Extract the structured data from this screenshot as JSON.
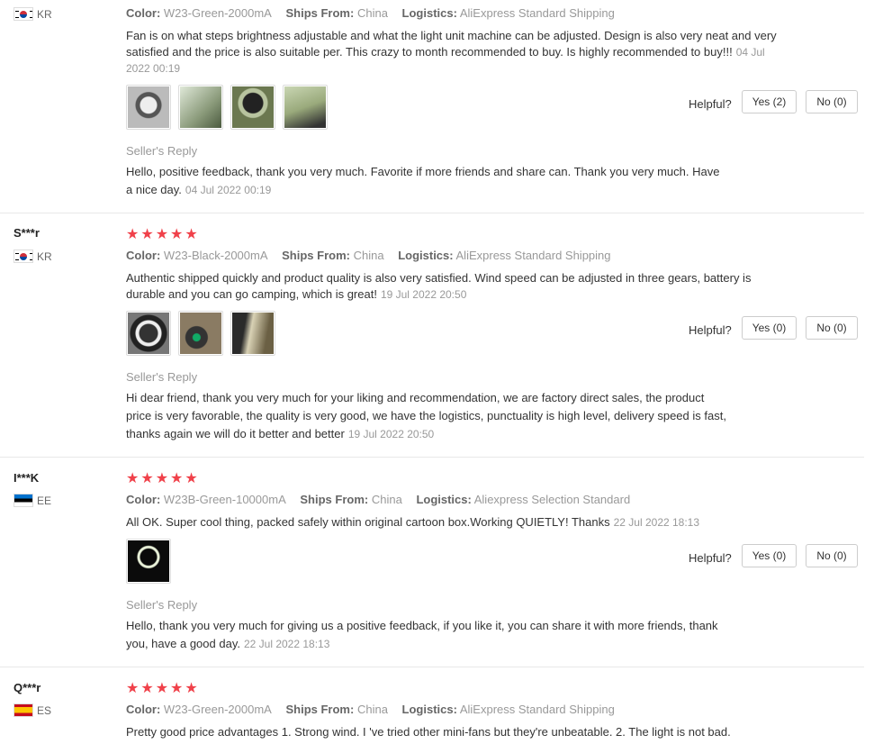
{
  "reviews": [
    {
      "user": "",
      "country": "KR",
      "stars": "★★★★★",
      "color_label": "Color:",
      "color": "W23-Green-2000mA",
      "ships_label": "Ships From:",
      "ships": "China",
      "logistics_label": "Logistics:",
      "logistics": "AliExpress Standard Shipping",
      "text": "Fan is on what steps brightness adjustable and what the light unit machine can be adjusted. Design is also very neat and very satisfied and the price is also suitable per. This crazy to month recommended to buy. Is highly recommended to buy!!!",
      "date": "04 Jul 2022 00:19",
      "helpful_label": "Helpful?",
      "yes": "Yes (2)",
      "no": "No (0)",
      "seller_title": "Seller's Reply",
      "seller_reply": "Hello, positive feedback, thank you very much. Favorite if more friends and share can. Thank you very much. Have a nice day.",
      "seller_date": "04 Jul 2022 00:19"
    },
    {
      "user": "S***r",
      "country": "KR",
      "stars": "★★★★★",
      "color_label": "Color:",
      "color": "W23-Black-2000mA",
      "ships_label": "Ships From:",
      "ships": "China",
      "logistics_label": "Logistics:",
      "logistics": "AliExpress Standard Shipping",
      "text": "Authentic shipped quickly and product quality is also very satisfied. Wind speed can be adjusted in three gears, battery is durable and you can go camping, which is great!",
      "date": "19 Jul 2022 20:50",
      "helpful_label": "Helpful?",
      "yes": "Yes (0)",
      "no": "No (0)",
      "seller_title": "Seller's Reply",
      "seller_reply": "Hi dear friend, thank you very much for your liking and recommendation, we are factory direct sales, the product price is very favorable, the quality is very good, we have the logistics, punctuality is high level, delivery speed is fast, thanks again we will do it better and better",
      "seller_date": "19 Jul 2022 20:50"
    },
    {
      "user": "I***K",
      "country": "EE",
      "stars": "★★★★★",
      "color_label": "Color:",
      "color": "W23B-Green-10000mA",
      "ships_label": "Ships From:",
      "ships": "China",
      "logistics_label": "Logistics:",
      "logistics": "Aliexpress Selection Standard",
      "text": "All OK. Super cool thing, packed safely within original cartoon box.Working QUIETLY! Thanks",
      "date": "22 Jul 2022 18:13",
      "helpful_label": "Helpful?",
      "yes": "Yes (0)",
      "no": "No (0)",
      "seller_title": "Seller's Reply",
      "seller_reply": "Hello, thank you very much for giving us a positive feedback, if you like it, you can share it with more friends, thank you, have a good day.",
      "seller_date": "22 Jul 2022 18:13"
    },
    {
      "user": "Q***r",
      "country": "ES",
      "stars": "★★★★★",
      "color_label": "Color:",
      "color": "W23-Green-2000mA",
      "ships_label": "Ships From:",
      "ships": "China",
      "logistics_label": "Logistics:",
      "logistics": "AliExpress Standard Shipping",
      "text": "Pretty good price advantages 1. Strong wind. I 've tried other mini-fans but they're unbeatable. 2. The light is not bad."
    }
  ]
}
